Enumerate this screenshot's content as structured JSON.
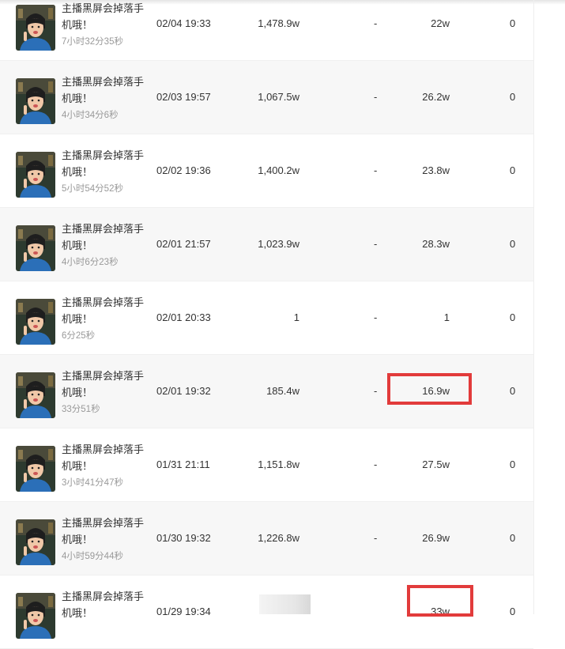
{
  "rows": [
    {
      "title": "主播黑屏会掉落手机哦！",
      "duration": "7小时32分35秒",
      "date": "02/04 19:33",
      "views": "1,478.9w",
      "dash": "-",
      "likes": "22w",
      "zero": "0"
    },
    {
      "title": "主播黑屏会掉落手机哦！",
      "duration": "4小时34分6秒",
      "date": "02/03 19:57",
      "views": "1,067.5w",
      "dash": "-",
      "likes": "26.2w",
      "zero": "0"
    },
    {
      "title": "主播黑屏会掉落手机哦！",
      "duration": "5小时54分52秒",
      "date": "02/02 19:36",
      "views": "1,400.2w",
      "dash": "-",
      "likes": "23.8w",
      "zero": "0"
    },
    {
      "title": "主播黑屏会掉落手机哦！",
      "duration": "4小时6分23秒",
      "date": "02/01 21:57",
      "views": "1,023.9w",
      "dash": "-",
      "likes": "28.3w",
      "zero": "0"
    },
    {
      "title": "主播黑屏会掉落手机哦！",
      "duration": "6分25秒",
      "date": "02/01 20:33",
      "views": "1",
      "dash": "-",
      "likes": "1",
      "zero": "0"
    },
    {
      "title": "主播黑屏会掉落手机哦！",
      "duration": "33分51秒",
      "date": "02/01 19:32",
      "views": "185.4w",
      "dash": "-",
      "likes": "16.9w",
      "zero": "0"
    },
    {
      "title": "主播黑屏会掉落手机哦！",
      "duration": "3小时41分47秒",
      "date": "01/31 21:11",
      "views": "1,151.8w",
      "dash": "-",
      "likes": "27.5w",
      "zero": "0"
    },
    {
      "title": "主播黑屏会掉落手机哦！",
      "duration": "4小时59分44秒",
      "date": "01/30 19:32",
      "views": "1,226.8w",
      "dash": "-",
      "likes": "26.9w",
      "zero": "0"
    },
    {
      "title": "主播黑屏会掉落手机哦！",
      "duration": "",
      "date": "01/29 19:34",
      "views": "",
      "dash": "",
      "likes": "33w",
      "zero": "0"
    }
  ],
  "colors": {
    "highlight": "#e23b3b",
    "alt_row": "#f7f7f7"
  },
  "thumbnail_icon": "streamer-avatar-thumbnail"
}
